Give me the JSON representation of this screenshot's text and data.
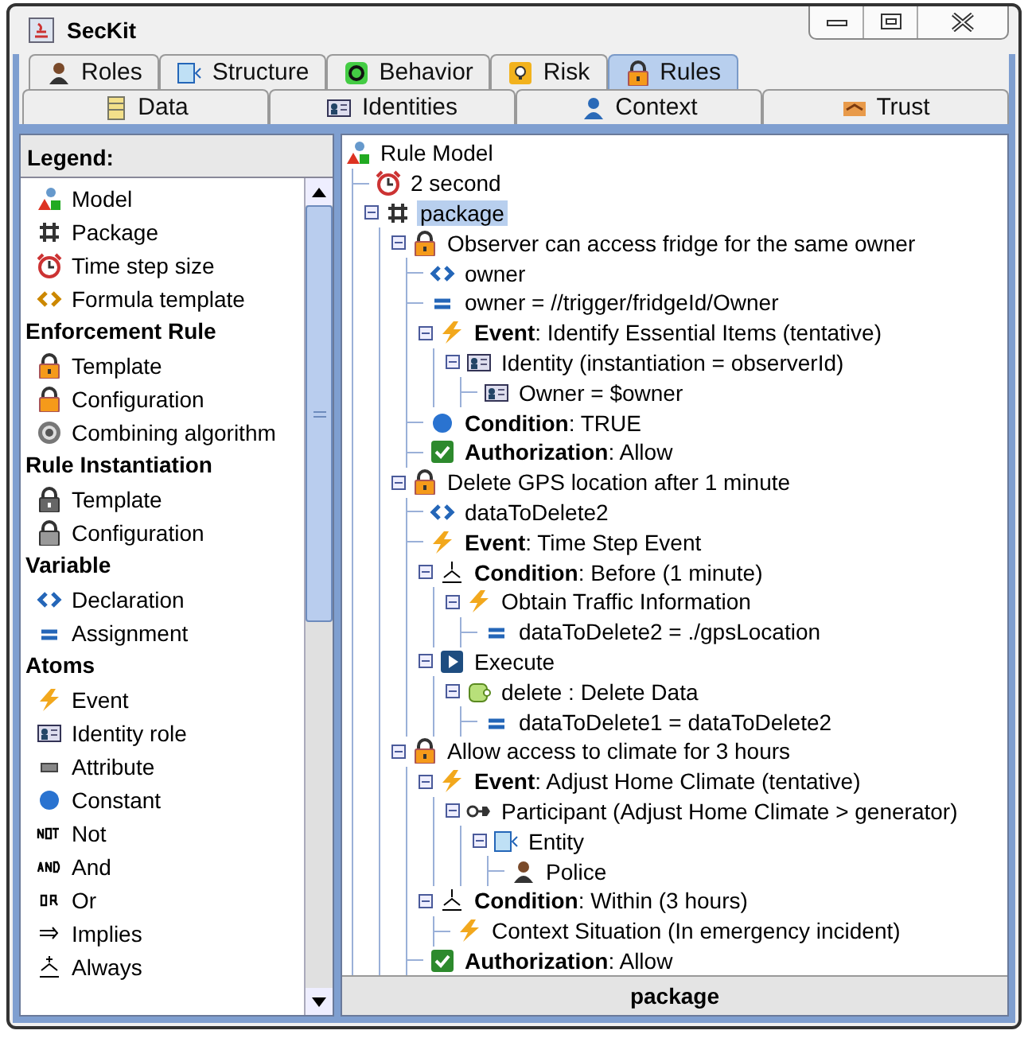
{
  "window": {
    "title": "SecKit"
  },
  "tabs": [
    {
      "label": "Roles",
      "kind": "police",
      "selected": false
    },
    {
      "label": "Structure",
      "kind": "entity",
      "selected": false
    },
    {
      "label": "Behavior",
      "kind": "behavior",
      "selected": false
    },
    {
      "label": "Risk",
      "kind": "risk",
      "selected": false
    },
    {
      "label": "Rules",
      "kind": "lock",
      "selected": true
    }
  ],
  "subtabs": [
    {
      "label": "Data",
      "kind": "data",
      "selected": false
    },
    {
      "label": "Identities",
      "kind": "identity",
      "selected": false
    },
    {
      "label": "Context",
      "kind": "context",
      "selected": false
    },
    {
      "label": "Trust",
      "kind": "trust",
      "selected": false
    }
  ],
  "legend": {
    "title": "Legend:",
    "sections": [
      {
        "items": [
          {
            "label": "Model",
            "kind": "model"
          },
          {
            "label": "Package",
            "kind": "package"
          },
          {
            "label": "Time step size",
            "kind": "clock"
          },
          {
            "label": "Formula template",
            "kind": "formula"
          }
        ]
      },
      {
        "heading": "Enforcement Rule",
        "items": [
          {
            "label": "Template",
            "kind": "lock"
          },
          {
            "label": "Configuration",
            "kind": "lock2"
          },
          {
            "label": "Combining algorithm",
            "kind": "gear"
          }
        ]
      },
      {
        "heading": "Rule Instantiation",
        "items": [
          {
            "label": "Template",
            "kind": "greylock"
          },
          {
            "label": "Configuration",
            "kind": "greylock2"
          }
        ]
      },
      {
        "heading": "Variable",
        "items": [
          {
            "label": "Declaration",
            "kind": "declaration"
          },
          {
            "label": "Assignment",
            "kind": "assignment"
          }
        ]
      },
      {
        "heading": "Atoms",
        "items": [
          {
            "label": "Event",
            "kind": "event"
          },
          {
            "label": "Identity role",
            "kind": "identity"
          },
          {
            "label": "Attribute",
            "kind": "attribute"
          },
          {
            "label": "Constant",
            "kind": "constant"
          },
          {
            "label": "Not",
            "kind": "not"
          },
          {
            "label": "And",
            "kind": "and"
          },
          {
            "label": "Or",
            "kind": "or"
          },
          {
            "label": "Implies",
            "kind": "implies"
          },
          {
            "label": "Always",
            "kind": "always"
          }
        ]
      }
    ]
  },
  "tree": {
    "nodes": [
      {
        "label": "Rule Model",
        "kind": "model",
        "selected": false,
        "children": [
          {
            "label": "2 second",
            "kind": "clock",
            "selected": false
          },
          {
            "label": "package",
            "kind": "package",
            "selected": true,
            "expanded": true,
            "children": [
              {
                "label": "Observer can access fridge for the same owner",
                "kind": "lock",
                "selected": false,
                "expanded": true,
                "children": [
                  {
                    "label": "owner",
                    "kind": "declaration",
                    "selected": false
                  },
                  {
                    "label": "owner = //trigger/fridgeId/Owner",
                    "kind": "assignment",
                    "selected": false
                  },
                  {
                    "label": "**Event**: Identify Essential Items (tentative)",
                    "kind": "event",
                    "selected": false,
                    "expanded": true,
                    "children": [
                      {
                        "label": "Identity (instantiation = observerId)",
                        "kind": "identity",
                        "selected": false,
                        "expanded": true,
                        "children": [
                          {
                            "label": "Owner = $owner",
                            "kind": "identity",
                            "selected": false
                          }
                        ]
                      }
                    ]
                  },
                  {
                    "label": "**Condition**: TRUE",
                    "kind": "constant",
                    "selected": false
                  },
                  {
                    "label": "**Authorization**: Allow",
                    "kind": "check",
                    "selected": false
                  }
                ]
              },
              {
                "label": "Delete GPS location after 1 minute",
                "kind": "lock",
                "selected": false,
                "expanded": true,
                "children": [
                  {
                    "label": "dataToDelete2",
                    "kind": "declaration",
                    "selected": false
                  },
                  {
                    "label": "**Event**: Time Step Event",
                    "kind": "event",
                    "selected": false
                  },
                  {
                    "label": "**Condition**: Before (1 minute)",
                    "kind": "temporal",
                    "selected": false,
                    "expanded": true,
                    "children": [
                      {
                        "label": "Obtain Traffic Information",
                        "kind": "event",
                        "selected": false,
                        "expanded": true,
                        "children": [
                          {
                            "label": "dataToDelete2 = ./gpsLocation",
                            "kind": "assignment",
                            "selected": false
                          }
                        ]
                      }
                    ]
                  },
                  {
                    "label": "Execute",
                    "kind": "execute",
                    "selected": false,
                    "expanded": true,
                    "children": [
                      {
                        "label": "delete : Delete Data",
                        "kind": "action",
                        "selected": false,
                        "expanded": true,
                        "children": [
                          {
                            "label": "dataToDelete1 = dataToDelete2",
                            "kind": "assignment",
                            "selected": false
                          }
                        ]
                      }
                    ]
                  }
                ]
              },
              {
                "label": "Allow access to climate for 3 hours",
                "kind": "lock",
                "selected": false,
                "expanded": true,
                "children": [
                  {
                    "label": "**Event**: Adjust Home Climate (tentative)",
                    "kind": "event",
                    "selected": false,
                    "expanded": true,
                    "children": [
                      {
                        "label": "Participant (Adjust Home Climate > generator)",
                        "kind": "participant",
                        "selected": false,
                        "expanded": true,
                        "children": [
                          {
                            "label": "Entity",
                            "kind": "entity",
                            "selected": false,
                            "expanded": true,
                            "children": [
                              {
                                "label": "Police",
                                "kind": "police",
                                "selected": false
                              }
                            ]
                          }
                        ]
                      }
                    ]
                  },
                  {
                    "label": "**Condition**: Within (3 hours)",
                    "kind": "temporal",
                    "selected": false,
                    "expanded": true,
                    "children": [
                      {
                        "label": "Context Situation (In emergency incident)",
                        "kind": "event",
                        "selected": false
                      }
                    ]
                  },
                  {
                    "label": "**Authorization**: Allow",
                    "kind": "check",
                    "selected": false
                  }
                ]
              }
            ]
          }
        ]
      }
    ]
  },
  "status_bar": {
    "text": "package"
  }
}
